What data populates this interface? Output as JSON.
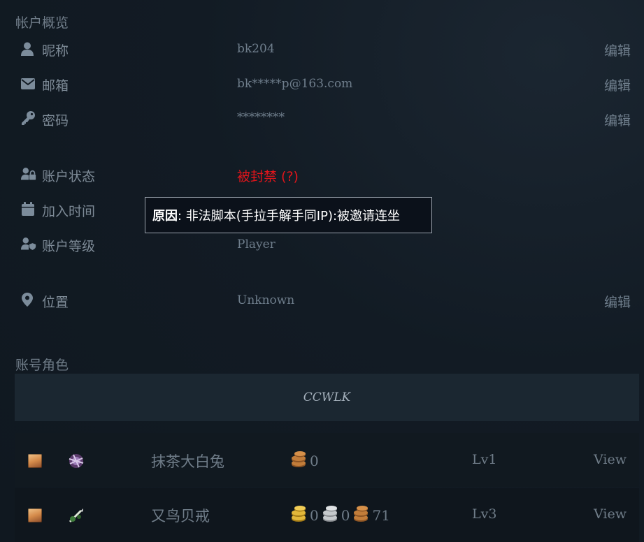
{
  "overview": {
    "title": "帐户概览",
    "rows": [
      {
        "label": "昵称",
        "value": "bk204",
        "edit": "编辑",
        "icon": "user-icon"
      },
      {
        "label": "邮箱",
        "value": "bk*****p@163.com",
        "edit": "编辑",
        "icon": "envelope-icon"
      },
      {
        "label": "密码",
        "value": "********",
        "edit": "编辑",
        "icon": "key-icon"
      }
    ],
    "status": {
      "label": "账户状态",
      "value": "被封禁 (?)",
      "icon": "user-lock-icon",
      "color": "#e0151b"
    },
    "joined": {
      "label": "加入时间",
      "icon": "calendar-icon"
    },
    "level": {
      "label": "账户等级",
      "value": "Player",
      "icon": "user-shield-icon"
    },
    "location": {
      "label": "位置",
      "value": "Unknown",
      "edit": "编辑",
      "icon": "map-pin-icon"
    }
  },
  "tooltip": {
    "bold": "原因",
    "text": ": 非法脚本(手拉手解手同IP):被邀请连坐"
  },
  "characters": {
    "title": "账号角色",
    "realm": "CCWLK",
    "list": [
      {
        "name": "抹茶大白兔",
        "race_icon": "human-female-portrait-icon",
        "class_icon": "class-warlock-icon",
        "gold": null,
        "silver": null,
        "copper": "0",
        "level": "Lv1",
        "view": "View"
      },
      {
        "name": "又鸟贝戒",
        "race_icon": "human-female-portrait-icon",
        "class_icon": "class-rogue-icon",
        "gold": "0",
        "silver": "0",
        "copper": "71",
        "level": "Lv3",
        "view": "View"
      }
    ]
  },
  "colors": {
    "gold": "#e2b73a",
    "silver": "#c5c9cc",
    "copper": "#c27d3a"
  }
}
